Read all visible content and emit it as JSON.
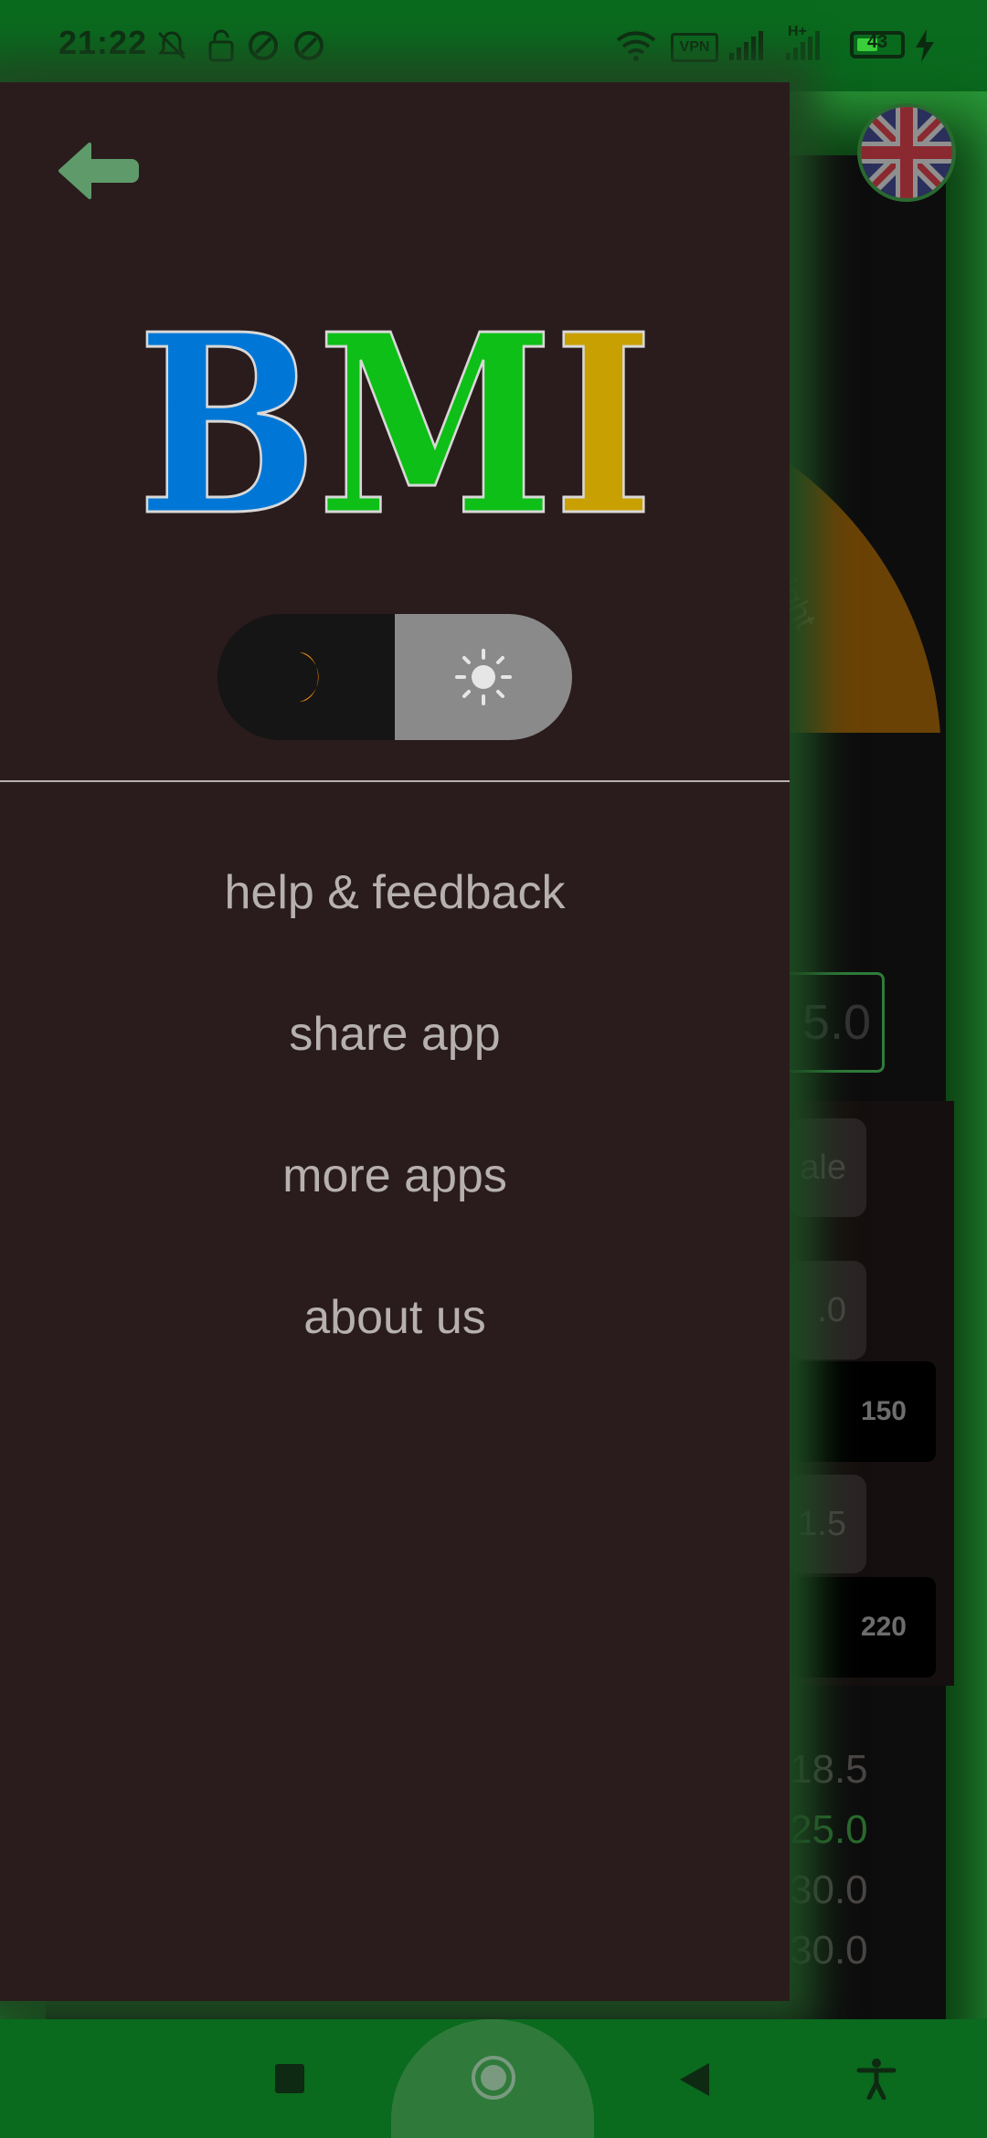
{
  "status_bar": {
    "time": "21:22",
    "battery": "43",
    "vpn_label": "VPN",
    "network_type": "H+"
  },
  "drawer": {
    "logo_text": "BMI",
    "logo_letters": [
      {
        "char": "B",
        "color": "#0077d6"
      },
      {
        "char": "M",
        "color": "#0dbf16"
      },
      {
        "char": "I",
        "color": "#c9a002"
      }
    ],
    "theme_toggle": {
      "dark_icon": "moon-icon",
      "light_icon": "sun-icon",
      "selected": "light"
    },
    "menu": [
      {
        "label": "help & feedback"
      },
      {
        "label": "share app"
      },
      {
        "label": "more apps"
      },
      {
        "label": "about us"
      }
    ]
  },
  "background_app": {
    "gauge_label": "weight",
    "weight_value": "5.0",
    "gender_partial": "ale",
    "height_partial": ".0",
    "height_slider_max": "150",
    "weight_partial": "1.5",
    "weight_slider_max": "220",
    "scale_values": [
      "18.5",
      "25.0",
      "30.0",
      "30.0"
    ]
  },
  "colors": {
    "accent_green": "#0a6a1e",
    "drawer_bg": "#2a1c1c",
    "gauge_orange": "#6b4206",
    "moon_orange": "#e8860c"
  }
}
